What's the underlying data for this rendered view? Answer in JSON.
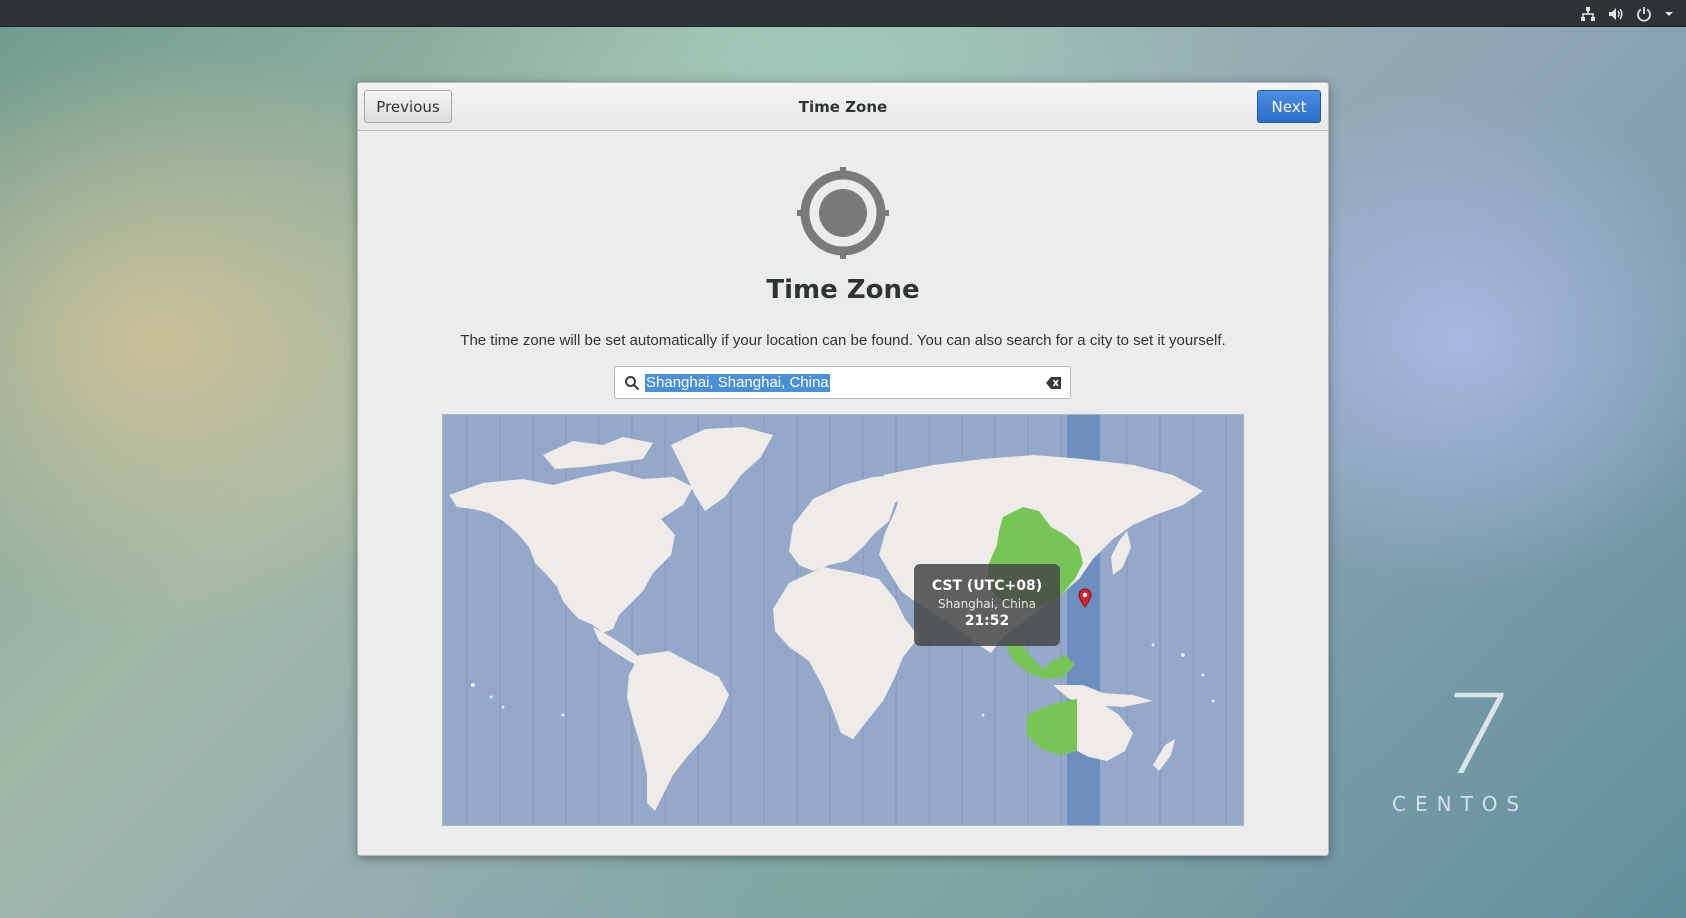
{
  "topbar": {
    "icons": [
      "network-icon",
      "volume-icon",
      "power-icon",
      "chevron-down-icon"
    ]
  },
  "dialog": {
    "header": {
      "previous_label": "Previous",
      "title": "Time Zone",
      "next_label": "Next"
    },
    "icon": "location-target-icon",
    "page_title": "Time Zone",
    "description": "The time zone will be set automatically if your location can be found. You can also search for a city to set it yourself.",
    "search": {
      "value": "Shanghai, Shanghai, China",
      "selected": true
    },
    "map": {
      "tooltip": {
        "zone": "CST (UTC+08)",
        "city": "Shanghai, China",
        "time": "21:52"
      },
      "highlight_color": "#76c555",
      "ocean_color": "#94a9c9",
      "selected_band_color": "#6e8ebf"
    }
  },
  "watermark": {
    "number": "7",
    "word": "CENTOS"
  }
}
